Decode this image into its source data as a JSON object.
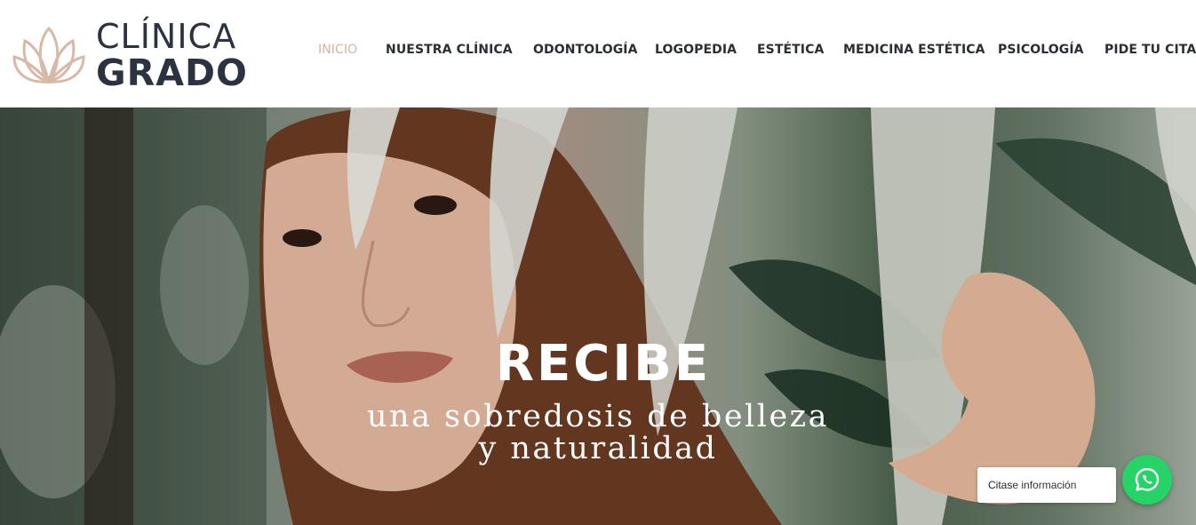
{
  "brand": {
    "line1": "CLÍNICA",
    "line2": "GRADO",
    "logo_color": "#d8b8a6",
    "text_color": "#2c3340"
  },
  "nav": {
    "items": [
      {
        "label": "INICIO",
        "active": true
      },
      {
        "label": "NUESTRA CLÍNICA",
        "active": false
      },
      {
        "label": "ODONTOLOGÍA",
        "active": false
      },
      {
        "label": "LOGOPEDIA",
        "active": false
      },
      {
        "label": "ESTÉTICA",
        "active": false
      },
      {
        "label": "MEDICINA ESTÉTICA",
        "active": false
      },
      {
        "label": "PSICOLOGÍA",
        "active": false
      },
      {
        "label": "PIDE TU CITA",
        "active": false
      }
    ],
    "active_color": "#d1b4a3"
  },
  "hero": {
    "title": "RECIBE",
    "subtitle": "una sobredosis de belleza y naturalidad"
  },
  "chat_widget": {
    "label_bold": "Citas",
    "label_rest": " e información",
    "icon": "whatsapp-icon",
    "color": "#25d366"
  }
}
